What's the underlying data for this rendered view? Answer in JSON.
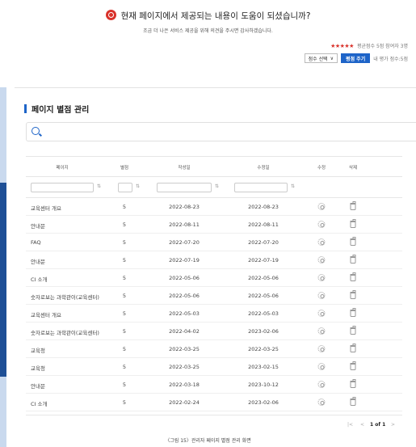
{
  "feedback": {
    "question": "현재 페이지에서 제공되는 내용이 도움이 되셨습니까?",
    "subtitle": "조금 더 나은 서비스 제공을 위해 의견을 주시면 감사하겠습니다.",
    "stars": "★★★★★",
    "rating_text": "평균점수 5점 참여자 3명",
    "score_select_label": "점수 선택",
    "score_submit_label": "평점 주기",
    "my_score_text": "내 평가 점수:5점"
  },
  "panel": {
    "title": "페이지 별점 관리"
  },
  "table": {
    "columns": {
      "page": "페이지",
      "rating": "별점",
      "created": "작성일",
      "updated": "수정일",
      "edit": "수정",
      "delete": "삭제"
    },
    "sort_icon": "⇅",
    "rows": [
      {
        "page": "교육센터 개요",
        "rating": "5",
        "created": "2022-08-23",
        "updated": "2022-08-23"
      },
      {
        "page": "안내문",
        "rating": "5",
        "created": "2022-08-11",
        "updated": "2022-08-11"
      },
      {
        "page": "FAQ",
        "rating": "5",
        "created": "2022-07-20",
        "updated": "2022-07-20"
      },
      {
        "page": "안내문",
        "rating": "5",
        "created": "2022-07-19",
        "updated": "2022-07-19"
      },
      {
        "page": "CI 소개",
        "rating": "5",
        "created": "2022-05-06",
        "updated": "2022-05-06"
      },
      {
        "page": "숫자로보는 과학관이(교육센터)",
        "rating": "5",
        "created": "2022-05-06",
        "updated": "2022-05-06"
      },
      {
        "page": "교육센터 개요",
        "rating": "5",
        "created": "2022-05-03",
        "updated": "2022-05-03"
      },
      {
        "page": "숫자로보는 과학관이(교육센터)",
        "rating": "5",
        "created": "2022-04-02",
        "updated": "2023-02-06"
      },
      {
        "page": "교육청",
        "rating": "5",
        "created": "2022-03-25",
        "updated": "2022-03-25"
      },
      {
        "page": "교육청",
        "rating": "5",
        "created": "2022-03-25",
        "updated": "2023-02-15"
      },
      {
        "page": "안내문",
        "rating": "5",
        "created": "2022-03-18",
        "updated": "2023-10-12"
      },
      {
        "page": "CI 소개",
        "rating": "5",
        "created": "2022-02-24",
        "updated": "2023-02-06"
      }
    ]
  },
  "pagination": {
    "first": "|<",
    "prev": "<",
    "info": "1 of 1",
    "next": ">"
  },
  "footnote": "〈그림 15〉관리자 페이지 별점 관리 화면"
}
